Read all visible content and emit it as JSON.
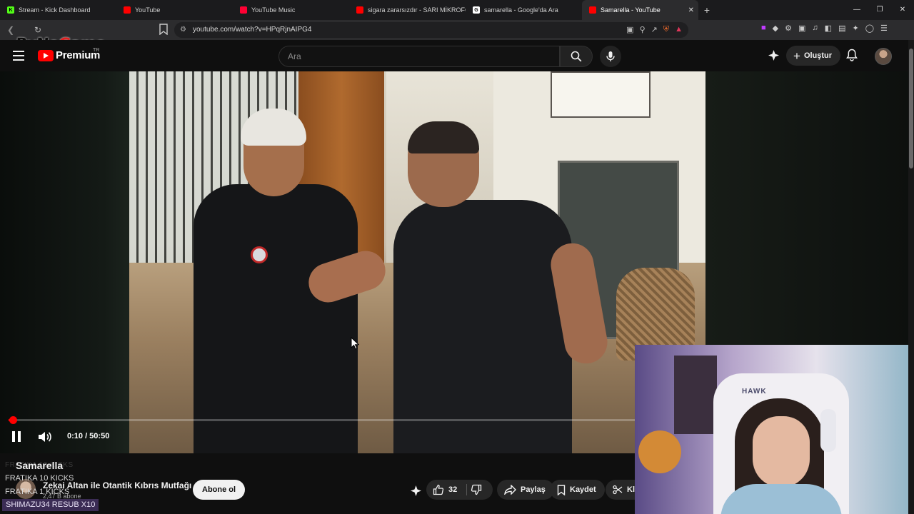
{
  "browser": {
    "tabs": [
      {
        "title": "Stream - Kick Dashboard",
        "fav": "K",
        "fav_color": "#53fc18",
        "active": false
      },
      {
        "title": "YouTube",
        "fav": "",
        "fav_color": "#ff0000",
        "active": false
      },
      {
        "title": "YouTube Music",
        "fav": "",
        "fav_color": "#ff0033",
        "active": false
      },
      {
        "title": "sigara zararsızdır - SARI MİKROFON",
        "fav": "",
        "fav_color": "#ff0000",
        "active": false
      },
      {
        "title": "samarella - Google'da Ara",
        "fav": "G",
        "fav_color": "#ffffff",
        "active": false
      },
      {
        "title": "Samarella - YouTube",
        "fav": "",
        "fav_color": "#ff0000",
        "active": true
      }
    ],
    "new_tab": "+",
    "url": "youtube.com/watch?v=HPqRjnAIPG4",
    "overlay_logo_a": "ByNo",
    "overlay_logo_b": "Game"
  },
  "header": {
    "brand": "Premium",
    "region": "TR",
    "search_placeholder": "Ara",
    "create_label": "Oluştur"
  },
  "player": {
    "time": "0:10 / 50:50",
    "progress": 0.0033,
    "playing": true
  },
  "video": {
    "title": "Samarella",
    "channel_name": "Zekai Altan ile Otantik Kıbrıs Mutfağı",
    "channel_subs": "2,47 B abone",
    "subscribe_label": "Abone ol",
    "likes": "32",
    "share_label": "Paylaş",
    "save_label": "Kaydet",
    "clip_label": "Kl"
  },
  "stream_overlay": {
    "faded_line": "FRATIKA  10 KICKS",
    "kicks_1": "FRATIKA  10 KICKS",
    "kicks_2": "FRATIKA  1 KICKS",
    "resub": "SHIMAZU34  RESUB X10",
    "cam_chair_brand": "HAWK"
  },
  "colors": {
    "brand_red": "#ff0000",
    "background": "#0f0f0f",
    "pill_bg": "#272727",
    "resub_bg": "#3b2c55"
  }
}
